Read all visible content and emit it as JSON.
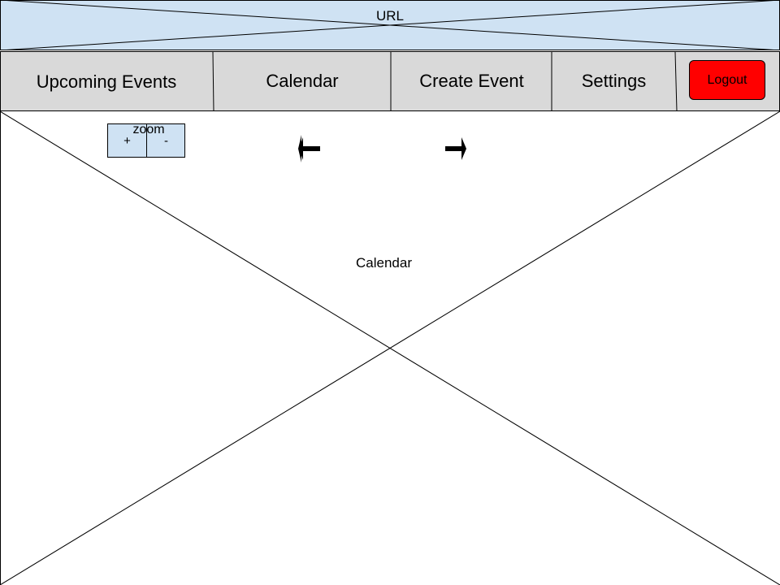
{
  "url_bar": {
    "label": "URL",
    "color": "#cfe2f3"
  },
  "nav": {
    "background": "#d9d9d9",
    "items": [
      {
        "label": "Upcoming Events"
      },
      {
        "label": "Calendar"
      },
      {
        "label": "Create Event"
      },
      {
        "label": "Settings"
      }
    ],
    "logout": {
      "label": "Logout",
      "color": "#ff0000"
    }
  },
  "main": {
    "placeholder_label": "Calendar",
    "zoom": {
      "label": "zoom",
      "in_label": "+",
      "out_label": "-"
    },
    "prev_icon": "arrow-left-icon",
    "next_icon": "arrow-right-icon"
  }
}
